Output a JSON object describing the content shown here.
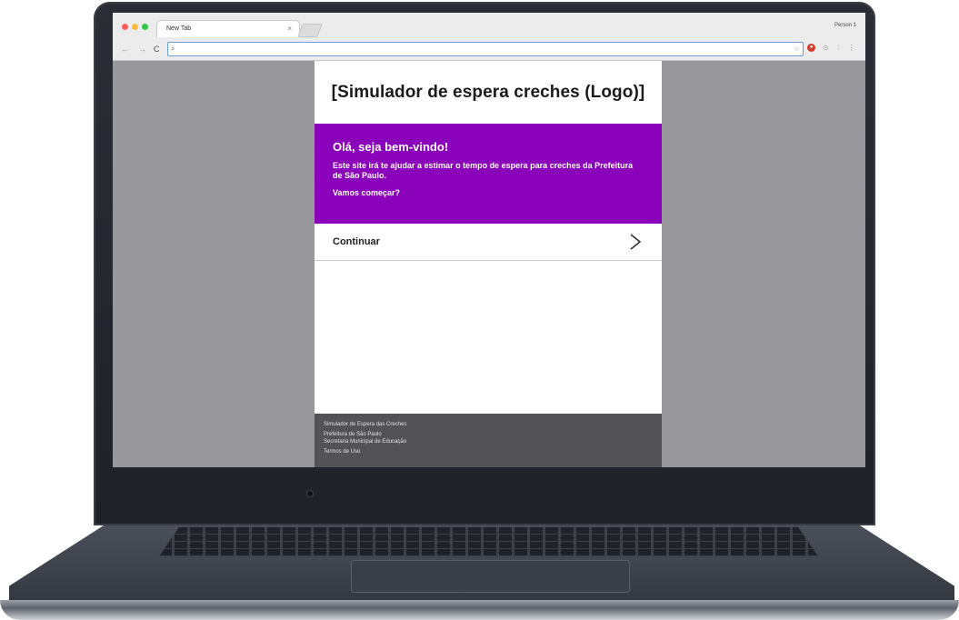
{
  "browser": {
    "tab_title": "New Tab",
    "tab_close": "×",
    "profile_name": "Person 1",
    "search_icon_glyph": "⌕",
    "address_value": "",
    "nav": {
      "back_glyph": "←",
      "forward_glyph": "→",
      "reload_glyph": "C"
    },
    "extension_badge": "●",
    "bookmark_glyph": "☆",
    "extension_glyph_2": "⊙",
    "extension_glyph_3": "⁝",
    "menu_glyph": "⋮"
  },
  "page": {
    "logo_text": "[Simulador de espera creches (Logo)]",
    "welcome": {
      "title": "Olá, seja bem-vindo!",
      "text": "Este site irá te ajudar a estimar o tempo de espera para creches da Prefeitura de São Paulo.",
      "cta": "Vamos começar?",
      "background": "#8a02b9"
    },
    "continue_label": "Continuar",
    "footer": {
      "line1": "Simulador de Espera das Creches",
      "line2": "Prefeitura de São Paulo",
      "line3": "Secretaria Municipal de Educação",
      "line4": "Termos de Uso"
    }
  },
  "icons": {
    "chevron": "chevron-right-icon",
    "search": "search-icon"
  }
}
